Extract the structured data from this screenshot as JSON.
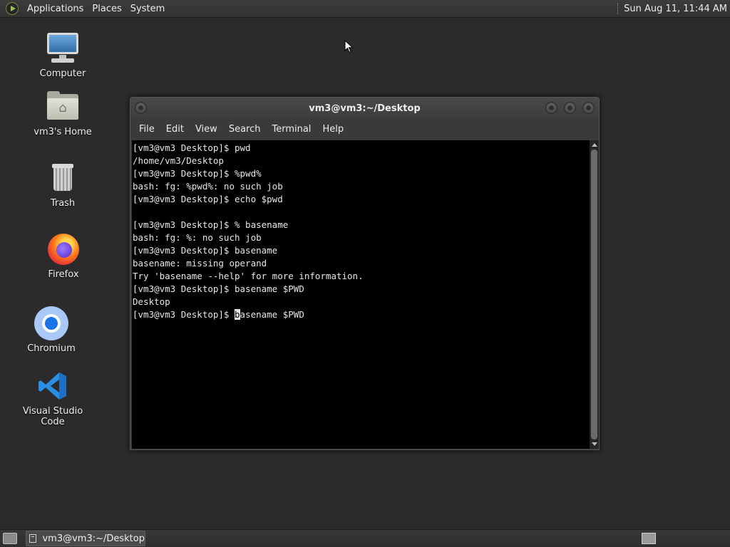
{
  "top_panel": {
    "menus": [
      "Applications",
      "Places",
      "System"
    ],
    "clock": "Sun Aug 11, 11:44 AM"
  },
  "desktop_icons": [
    {
      "label": "Computer",
      "icon": "computer-icon"
    },
    {
      "label": "vm3's Home",
      "icon": "home-folder-icon"
    },
    {
      "label": "Trash",
      "icon": "trash-icon"
    },
    {
      "label": "Firefox",
      "icon": "firefox-icon"
    },
    {
      "label": "Chromium",
      "icon": "chromium-icon"
    },
    {
      "label": "Visual Studio Code",
      "icon": "vscode-icon"
    }
  ],
  "terminal": {
    "title": "vm3@vm3:~/Desktop",
    "menus": [
      "File",
      "Edit",
      "View",
      "Search",
      "Terminal",
      "Help"
    ],
    "lines": [
      "[vm3@vm3 Desktop]$ pwd",
      "/home/vm3/Desktop",
      "[vm3@vm3 Desktop]$ %pwd%",
      "bash: fg: %pwd%: no such job",
      "[vm3@vm3 Desktop]$ echo $pwd",
      "",
      "[vm3@vm3 Desktop]$ % basename",
      "bash: fg: %: no such job",
      "[vm3@vm3 Desktop]$ basename",
      "basename: missing operand",
      "Try 'basename --help' for more information.",
      "[vm3@vm3 Desktop]$ basename $PWD",
      "Desktop"
    ],
    "current_line": {
      "prompt": "[vm3@vm3 Desktop]$ ",
      "cursor_char": "b",
      "rest": "asename $PWD"
    }
  },
  "taskbar": {
    "tasks": [
      {
        "label": "vm3@vm3:~/Desktop"
      }
    ]
  },
  "colors": {
    "desktop_bg": "#2b2b2b",
    "terminal_bg": "#000000",
    "terminal_fg": "#e6e6e6"
  }
}
